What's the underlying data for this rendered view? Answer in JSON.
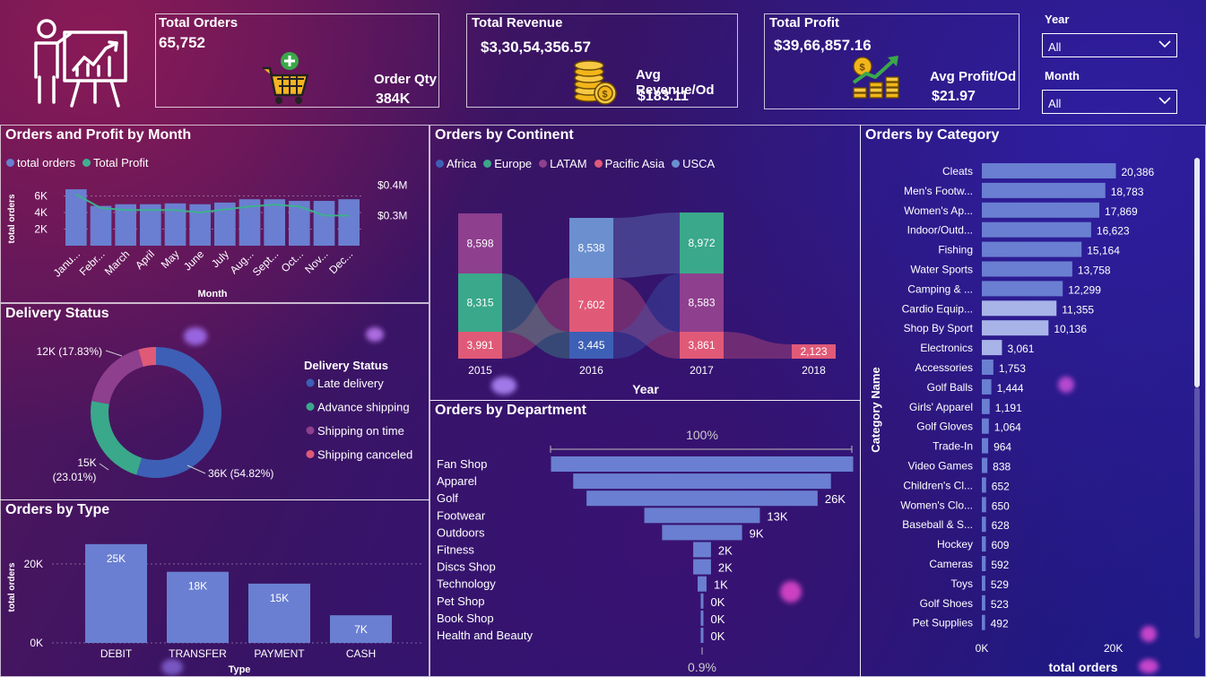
{
  "colors": {
    "bar_blue": "#6a7fd1",
    "teal": "#3aaa8c",
    "africa": "#3d5fb5",
    "europe": "#3aa88a",
    "latam": "#8e3f8e",
    "pacific_asia": "#e05a78",
    "usca": "#6b8fcf",
    "profit_line": "#3fb08f",
    "late_delivery": "#3d5fb5",
    "advance_shipping": "#3aa88a",
    "shipping_on_time": "#8e3f8e",
    "shipping_canceled": "#e05a78"
  },
  "kpis": {
    "orders": {
      "title": "Total Orders",
      "value": "65,752",
      "sub_label": "Order Qty",
      "sub_value": "384K",
      "icon": "shopping-cart-icon"
    },
    "revenue": {
      "title": "Total Revenue",
      "value": "$3,30,54,356.57",
      "sub_label": "Avg Revenue/Od",
      "sub_value": "$183.11",
      "icon": "coins-icon"
    },
    "profit": {
      "title": "Total Profit",
      "value": "$39,66,857.16",
      "sub_label": "Avg Profit/Od",
      "sub_value": "$21.97",
      "icon": "profit-growth-icon"
    }
  },
  "filters": {
    "year": {
      "label": "Year",
      "value": "All"
    },
    "month": {
      "label": "Month",
      "value": "All"
    }
  },
  "panels": {
    "month": "Orders and Profit by Month",
    "continent": "Orders by Continent",
    "category": "Orders by Category",
    "delivery": "Delivery Status",
    "department": "Orders by Department",
    "type": "Orders by Type"
  },
  "chart_data": [
    {
      "id": "orders_profit_month",
      "type": "bar",
      "categories": [
        "Janu...",
        "Febr...",
        "March",
        "April",
        "May",
        "June",
        "July",
        "Aug...",
        "Sept...",
        "Oct...",
        "Nov...",
        "Dec..."
      ],
      "series": [
        {
          "name": "total orders",
          "values": [
            6800,
            4800,
            5000,
            5000,
            5100,
            5000,
            5200,
            5600,
            5600,
            5400,
            5400,
            5600
          ]
        },
        {
          "name": "Total Profit",
          "values": [
            0.37,
            0.325,
            0.318,
            0.318,
            0.318,
            0.31,
            0.32,
            0.33,
            0.336,
            0.33,
            0.3,
            0.3
          ]
        }
      ],
      "legend": [
        "total orders",
        "Total Profit"
      ],
      "xlabel": "Month",
      "ylabel": "total orders",
      "y_ticks": [
        "2K",
        "4K",
        "6K"
      ],
      "y2_ticks": [
        "$0.3M",
        "$0.4M"
      ],
      "ylim": [
        0,
        8000
      ],
      "y2lim": [
        0.2,
        0.42
      ]
    },
    {
      "id": "orders_continent",
      "type": "bar",
      "categories": [
        "2015",
        "2016",
        "2017",
        "2018"
      ],
      "legend": [
        "Africa",
        "Europe",
        "LATAM",
        "Pacific Asia",
        "USCA"
      ],
      "xlabel": "Year",
      "labels": [
        [
          {
            "series": "Pacific Asia",
            "value": "3,991"
          },
          {
            "series": "Europe",
            "value": "8,315"
          },
          {
            "series": "LATAM",
            "value": "8,598"
          }
        ],
        [
          {
            "series": "Africa",
            "value": "3,445"
          },
          {
            "series": "Pacific Asia",
            "value": "7,602"
          },
          {
            "series": "USCA",
            "value": "8,538"
          }
        ],
        [
          {
            "series": "Pacific Asia",
            "value": "3,861"
          },
          {
            "series": "LATAM",
            "value": "8,583"
          },
          {
            "series": "Europe",
            "value": "8,972"
          }
        ],
        [
          {
            "series": "Pacific Asia",
            "value": "2,123"
          }
        ]
      ]
    },
    {
      "id": "orders_category",
      "type": "bar",
      "orientation": "horizontal",
      "categories": [
        "Cleats",
        "Men's Footw...",
        "Women's Ap...",
        "Indoor/Outd...",
        "Fishing",
        "Water Sports",
        "Camping & ...",
        "Cardio Equip...",
        "Shop By Sport",
        "Electronics",
        "Accessories",
        "Golf Balls",
        "Girls' Apparel",
        "Golf Gloves",
        "Trade-In",
        "Video Games",
        "Children's Cl...",
        "Women's Clo...",
        "Baseball & S...",
        "Hockey",
        "Cameras",
        "Toys",
        "Golf Shoes",
        "Pet Supplies"
      ],
      "values": [
        20386,
        18783,
        17869,
        16623,
        15164,
        13758,
        12299,
        11355,
        10136,
        3061,
        1753,
        1444,
        1191,
        1064,
        964,
        838,
        652,
        650,
        628,
        609,
        592,
        529,
        523,
        492
      ],
      "value_labels": [
        "20,386",
        "18,783",
        "17,869",
        "16,623",
        "15,164",
        "13,758",
        "12,299",
        "11,355",
        "10,136",
        "3,061",
        "1,753",
        "1,444",
        "1,191",
        "1,064",
        "964",
        "838",
        "652",
        "650",
        "628",
        "609",
        "592",
        "529",
        "523",
        "492"
      ],
      "xlabel": "total orders",
      "ylabel": "Category Name",
      "x_ticks": [
        "0K",
        "20K"
      ],
      "xlim": [
        0,
        21000
      ]
    },
    {
      "id": "delivery_status",
      "type": "pie",
      "legend_title": "Delivery Status",
      "labels": [
        "Late delivery",
        "Advance shipping",
        "Shipping on time",
        "Shipping canceled"
      ],
      "values": [
        54.82,
        23.01,
        17.83,
        4.34
      ],
      "slice_labels": [
        "36K (54.82%)",
        "15K (23.01%)",
        "12K (17.83%)",
        ""
      ]
    },
    {
      "id": "orders_department",
      "type": "bar",
      "orientation": "funnel",
      "categories": [
        "Fan Shop",
        "Apparel",
        "Golf",
        "Footwear",
        "Outdoors",
        "Fitness",
        "Discs Shop",
        "Technology",
        "Pet Shop",
        "Book Shop",
        "Health and Beauty"
      ],
      "values": [
        34000,
        29000,
        26000,
        13000,
        9000,
        2000,
        2000,
        1000,
        300,
        300,
        300
      ],
      "value_labels": [
        "",
        "",
        "26K",
        "13K",
        "9K",
        "2K",
        "2K",
        "1K",
        "0K",
        "0K",
        "0K"
      ],
      "top_label": "100%",
      "bottom_label": "0.9%"
    },
    {
      "id": "orders_type",
      "type": "bar",
      "categories": [
        "DEBIT",
        "TRANSFER",
        "PAYMENT",
        "CASH"
      ],
      "values": [
        25000,
        18000,
        15000,
        7000
      ],
      "value_labels": [
        "25K",
        "18K",
        "15K",
        "7K"
      ],
      "xlabel": "Type",
      "ylabel": "total orders",
      "y_ticks": [
        "0K",
        "20K"
      ],
      "ylim": [
        0,
        27000
      ]
    }
  ]
}
